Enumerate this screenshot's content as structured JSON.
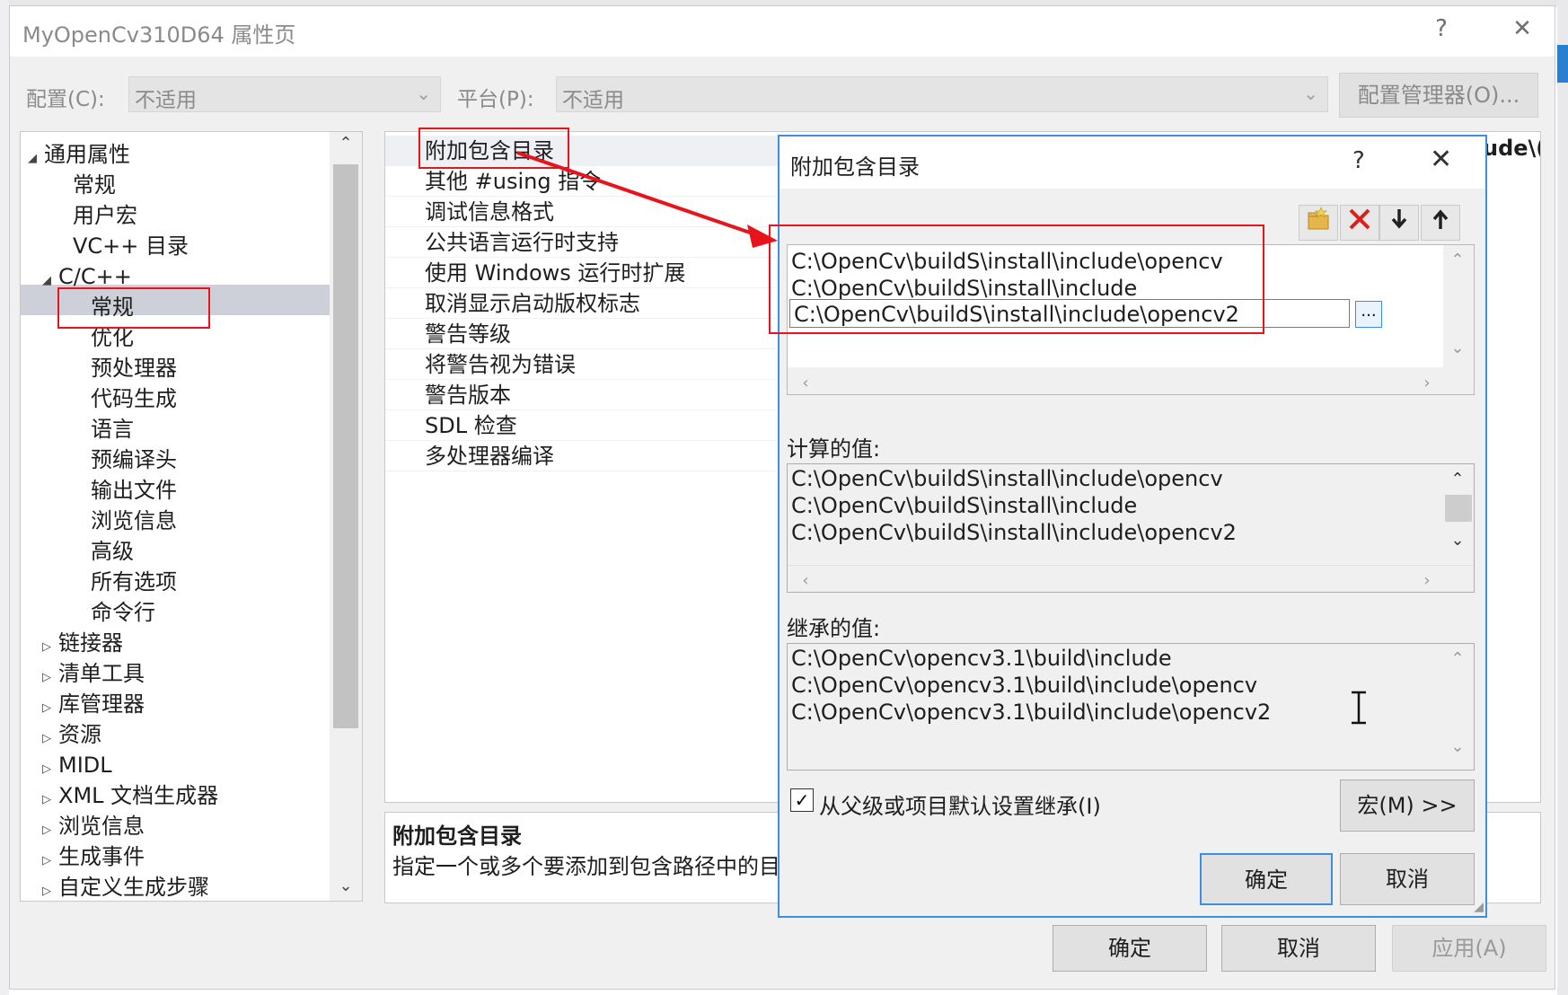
{
  "main_dialog": {
    "title": "MyOpenCv310D64 属性页",
    "help": "?",
    "close": "✕",
    "config_label": "配置(C):",
    "config_value": "不适用",
    "platform_label": "平台(P):",
    "platform_value": "不适用",
    "config_manager": "配置管理器(O)...",
    "ok": "确定",
    "cancel": "取消",
    "apply": "应用(A)"
  },
  "tree": {
    "items": [
      {
        "label": "通用属性",
        "arrow": "◢"
      },
      {
        "label": "常规"
      },
      {
        "label": "用户宏"
      },
      {
        "label": "VC++ 目录"
      },
      {
        "label": "C/C++",
        "arrow": "◢"
      },
      {
        "label": "常规"
      },
      {
        "label": "优化"
      },
      {
        "label": "预处理器"
      },
      {
        "label": "代码生成"
      },
      {
        "label": "语言"
      },
      {
        "label": "预编译头"
      },
      {
        "label": "输出文件"
      },
      {
        "label": "浏览信息"
      },
      {
        "label": "高级"
      },
      {
        "label": "所有选项"
      },
      {
        "label": "命令行"
      },
      {
        "label": "链接器",
        "arrow": "▷"
      },
      {
        "label": "清单工具",
        "arrow": "▷"
      },
      {
        "label": "库管理器",
        "arrow": "▷"
      },
      {
        "label": "资源",
        "arrow": "▷"
      },
      {
        "label": "MIDL",
        "arrow": "▷"
      },
      {
        "label": "XML 文档生成器",
        "arrow": "▷"
      },
      {
        "label": "浏览信息",
        "arrow": "▷"
      },
      {
        "label": "生成事件",
        "arrow": "▷"
      },
      {
        "label": "自定义生成步骤",
        "arrow": "▷"
      }
    ]
  },
  "properties": {
    "rows": [
      "附加包含目录",
      "其他 #using 指令",
      "调试信息格式",
      "公共语言运行时支持",
      "使用 Windows 运行时扩展",
      "取消显示启动版权标志",
      "警告等级",
      "将警告视为错误",
      "警告版本",
      "SDL 检查",
      "多处理器编译"
    ],
    "value_cut": "ude\\("
  },
  "description": {
    "title": "附加包含目录",
    "text": "指定一个或多个要添加到包含路径中的目"
  },
  "sub_dialog": {
    "title": "附加包含目录",
    "help": "?",
    "close": "✕",
    "edit_lines": [
      "C:\\OpenCv\\buildS\\install\\include\\opencv",
      "C:\\OpenCv\\buildS\\install\\include",
      "C:\\OpenCv\\buildS\\install\\include\\opencv2"
    ],
    "browse": "...",
    "computed_label": "计算的值:",
    "computed_lines": [
      "C:\\OpenCv\\buildS\\install\\include\\opencv",
      "C:\\OpenCv\\buildS\\install\\include",
      "C:\\OpenCv\\buildS\\install\\include\\opencv2"
    ],
    "inherited_label": "继承的值:",
    "inherited_lines": [
      "C:\\OpenCv\\opencv3.1\\build\\include",
      "C:\\OpenCv\\opencv3.1\\build\\include\\opencv",
      "C:\\OpenCv\\opencv3.1\\build\\include\\opencv2"
    ],
    "inherit_checkbox": "从父级或项目默认设置继承(I)",
    "macro": "宏(M) >>",
    "ok": "确定",
    "cancel": "取消"
  },
  "colors": {
    "annotation_red": "#e8141b",
    "accent_blue": "#3d8de0",
    "selection_gray": "#cdd0d8"
  }
}
